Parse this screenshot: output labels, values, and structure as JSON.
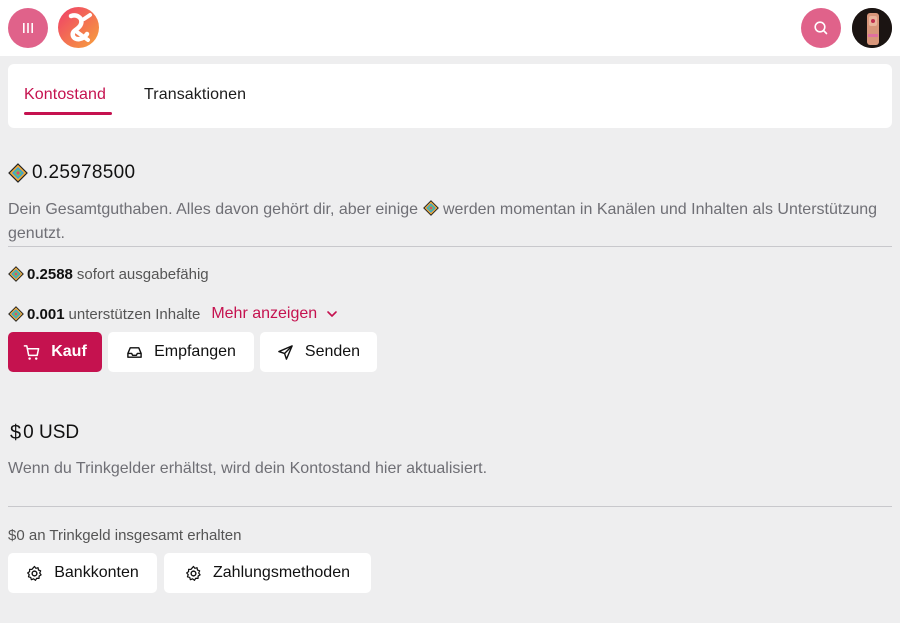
{
  "header": {
    "menu_icon": "menu-icon",
    "logo_icon": "odysee-logo",
    "search_icon": "search-icon",
    "avatar_icon": "user-avatar"
  },
  "tabs": [
    {
      "label": "Kontostand",
      "active": true
    },
    {
      "label": "Transaktionen",
      "active": false
    }
  ],
  "credits": {
    "total": "0.25978500",
    "description_part1": "Dein Gesamtguthaben. Alles davon gehört dir, aber einige",
    "description_part2": "werden momentan in Kanälen und Inhalten als Unterstützung genutzt.",
    "spendable_amount": "0.2588",
    "spendable_label": "sofort ausgabefähig",
    "supporting_amount": "0.001",
    "supporting_label": "unterstützen Inhalte",
    "show_more": "Mehr anzeigen"
  },
  "actions": {
    "buy": "Kauf",
    "receive": "Empfangen",
    "send": "Senden"
  },
  "usd": {
    "symbol": "$",
    "amount": "0 USD",
    "description": "Wenn du Trinkgelder erhältst, wird dein Kontostand hier aktualisiert.",
    "tips_total": "$0 an Trinkgeld insgesamt erhalten",
    "bank_accounts": "Bankkonten",
    "payment_methods": "Zahlungsmethoden"
  },
  "colors": {
    "accent": "#c5124f",
    "button_pink": "#e0628a",
    "background": "#eeeeef"
  }
}
